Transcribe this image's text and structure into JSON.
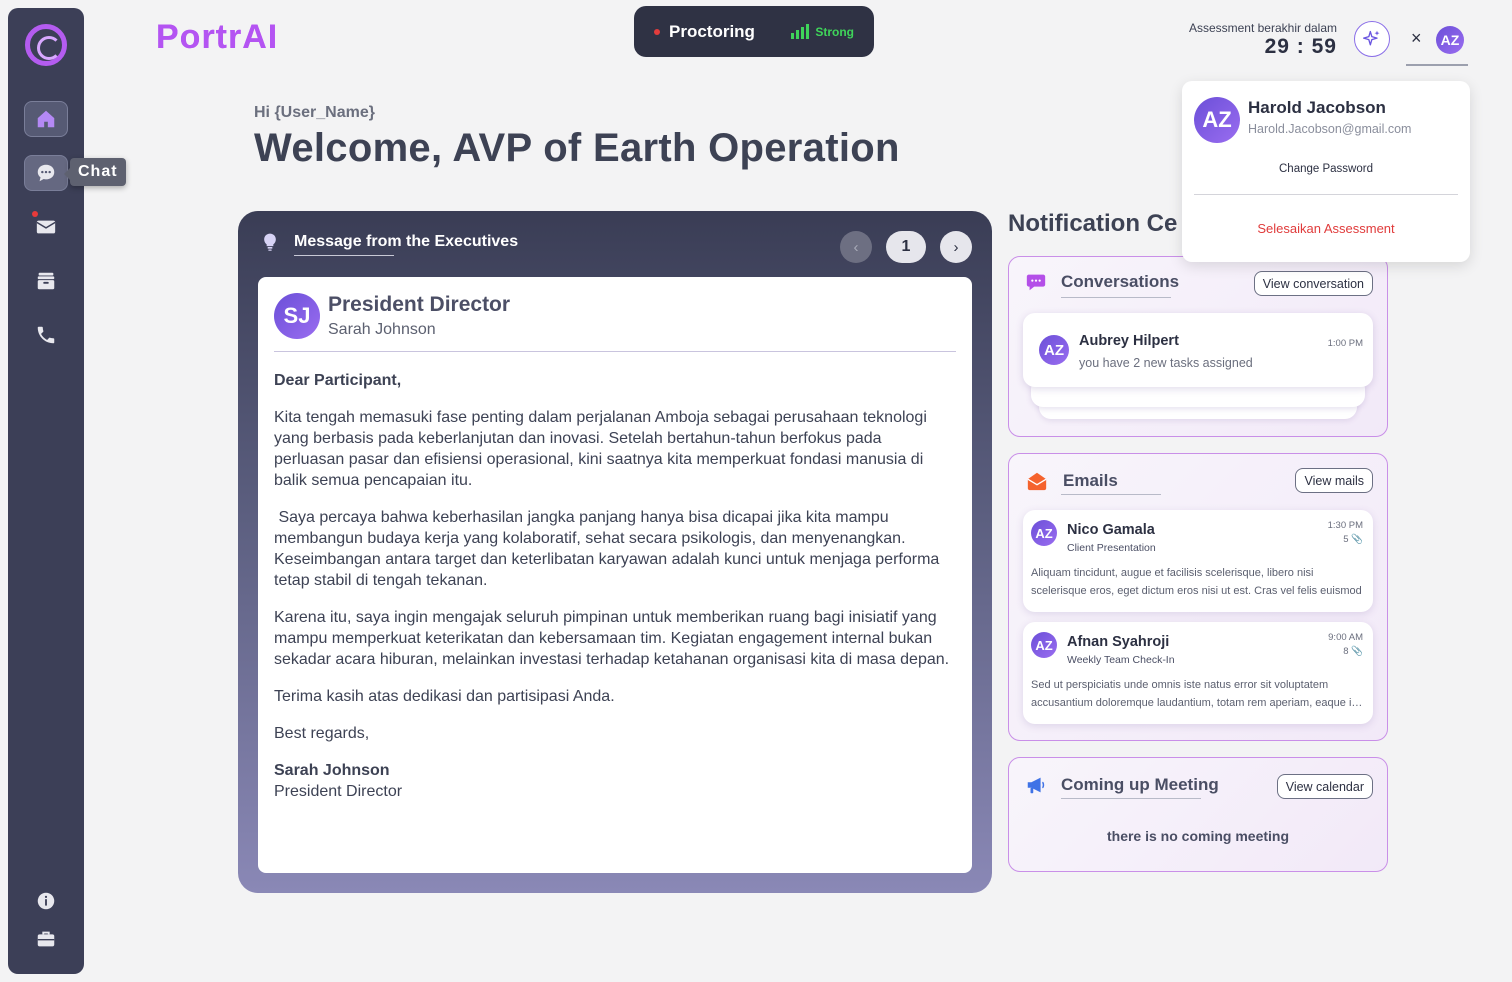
{
  "brand": "PortrAI",
  "sidebar": {
    "tooltip": "Chat",
    "items": [
      {
        "icon": "home-icon",
        "active": true
      },
      {
        "icon": "chat-icon",
        "active": true
      },
      {
        "icon": "mail-icon",
        "badge": true
      },
      {
        "icon": "archive-icon"
      },
      {
        "icon": "phone-icon"
      },
      {
        "icon": "info-icon"
      },
      {
        "icon": "briefcase-icon"
      }
    ]
  },
  "proctoring": {
    "label": "Proctoring",
    "signal": "Strong",
    "signal_color": "#3fd45a"
  },
  "assessment": {
    "label": "Assessment berakhir dalam",
    "timer": "29 : 59"
  },
  "topbar": {
    "close": "×",
    "avatar_initials": "AZ"
  },
  "greeting": {
    "hi": "Hi {User_Name}",
    "welcome": "Welcome, AVP of Earth Operation"
  },
  "message_card": {
    "title": "Message from the Executives",
    "page": "1",
    "sender_initials": "SJ",
    "sender_role": "President Director",
    "sender_name": "Sarah Johnson",
    "salutation": "Dear Participant,",
    "paragraphs": [
      "Kita tengah memasuki fase penting dalam perjalanan Amboja sebagai perusahaan teknologi yang berbasis pada keberlanjutan dan inovasi. Setelah bertahun-tahun berfokus pada perluasan pasar dan efisiensi operasional, kini saatnya kita memperkuat fondasi manusia di balik semua pencapaian itu.",
      " Saya percaya bahwa keberhasilan jangka panjang hanya bisa dicapai jika kita mampu membangun budaya kerja yang kolaboratif, sehat secara psikologis, dan menyenangkan. Keseimbangan antara target dan keterlibatan karyawan adalah kunci untuk menjaga performa tetap stabil di tengah tekanan.",
      "Karena itu, saya ingin mengajak seluruh pimpinan untuk memberikan ruang bagi inisiatif yang mampu memperkuat keterikatan dan kebersamaan tim. Kegiatan engagement internal bukan sekadar acara hiburan, melainkan investasi terhadap ketahanan organisasi kita di masa depan.",
      "Terima kasih atas dedikasi dan partisipasi Anda."
    ],
    "closing": "Best regards,",
    "signature_name": "Sarah Johnson",
    "signature_role": "President Director"
  },
  "notifications": {
    "title": "Notification Ce",
    "conversations": {
      "title": "Conversations",
      "button": "View conversation",
      "item": {
        "initials": "AZ",
        "name": "Aubrey Hilpert",
        "time": "1:00 PM",
        "text": "you have 2 new tasks assigned"
      }
    },
    "emails": {
      "title": "Emails",
      "button": "View mails",
      "items": [
        {
          "initials": "AZ",
          "name": "Nico Gamala",
          "subject": "Client Presentation",
          "time": "1:30 PM",
          "attachments": "5",
          "line1": "Aliquam tincidunt, augue et facilisis scelerisque, libero nisi",
          "line2": "scelerisque eros, eget dictum eros nisi ut est. Cras vel felis euismod"
        },
        {
          "initials": "AZ",
          "name": "Afnan Syahroji",
          "subject": "Weekly Team Check-In",
          "time": "9:00 AM",
          "attachments": "8",
          "line1": "Sed ut perspiciatis unde omnis iste natus error sit voluptatem",
          "line2": "accusantium doloremque laudantium, totam rem aperiam, eaque ipsa"
        }
      ]
    },
    "meetings": {
      "title": "Coming up Meeting",
      "button": "View calendar",
      "empty": "there is no coming meeting"
    }
  },
  "profile_menu": {
    "initials": "AZ",
    "name": "Harold Jacobson",
    "email": "Harold.Jacobson@gmail.com",
    "change_password": "Change Password",
    "finish": "Selesaikan Assessment"
  }
}
